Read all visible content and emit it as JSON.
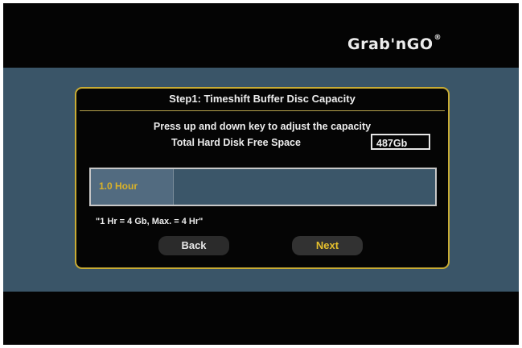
{
  "brand": {
    "logo_text": "Grab'nGO",
    "registered_mark": "®"
  },
  "dialog": {
    "title": "Step1: Timeshift Buffer Disc Capacity",
    "instruction": "Press up and down key to adjust the capacity",
    "free_space_label": "Total Hard Disk Free Space",
    "free_space_value": "487Gb",
    "capacity": {
      "label": "1.0 Hour",
      "current_hours": 1.0,
      "max_hours": 4,
      "note": "\"1 Hr = 4 Gb, Max. = 4 Hr\""
    },
    "buttons": {
      "back": "Back",
      "next": "Next"
    }
  },
  "colors": {
    "accent_gold": "#c9ac34",
    "band_blue": "#3a5568",
    "selected_text": "#e5bf2d",
    "background": "#040404"
  }
}
